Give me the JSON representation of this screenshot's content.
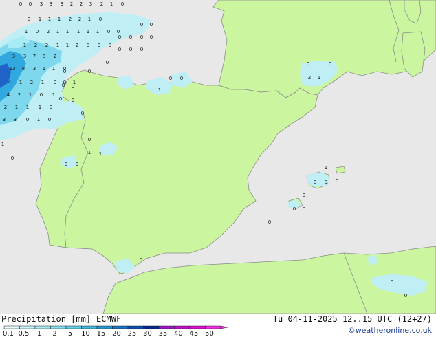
{
  "title": {
    "label": "Precipitation [mm]",
    "model": "ECMWF"
  },
  "valid_time": "Tu 04-11-2025 12..15 UTC (12+27)",
  "credit": "©weatheronline.co.uk",
  "colors": {
    "sea": "#e8e8e8",
    "land": "#ccf5a0",
    "border": "#8a8a8a",
    "precip_light": "#bfeef5",
    "precip_mid": "#7dd8ee",
    "precip_high": "#31a9e0",
    "precip_max": "#1f63c8"
  },
  "scale": {
    "ticks": [
      "0.1",
      "0.5",
      "1",
      "2",
      "5",
      "10",
      "15",
      "20",
      "25",
      "30",
      "35",
      "40",
      "45",
      "50"
    ],
    "colors": [
      "#e8fbfd",
      "#c8f3fa",
      "#a6ebf6",
      "#86e0f2",
      "#63d0ec",
      "#3fb9e3",
      "#2497d6",
      "#1773c4",
      "#0a4fb0",
      "#03288f",
      "#9d13c7",
      "#c10ecc",
      "#e00ad2",
      "#f72be6"
    ]
  },
  "map_values": {
    "row1": [
      "0",
      "0",
      "3",
      "3",
      "3",
      "2",
      "2",
      "3",
      "2",
      "1",
      "0"
    ],
    "row2": [
      "0",
      "1",
      "1",
      "1",
      "2",
      "2",
      "1",
      "0"
    ],
    "row3": [
      "1",
      "0",
      "2",
      "1",
      "1",
      "1",
      "1",
      "1",
      "0",
      "0"
    ],
    "row4": [
      "1",
      "2",
      "2",
      "1",
      "1",
      "2",
      "0",
      "0",
      "0"
    ],
    "row5": [
      "3",
      "3",
      "7",
      "8",
      "2"
    ],
    "row6": [
      "13",
      "8",
      "3",
      "1",
      "1",
      "0"
    ],
    "row7": [
      "4",
      "1",
      "2",
      "1",
      "0",
      "0",
      "1"
    ],
    "row8": [
      "4",
      "2",
      "1",
      "0",
      "1"
    ],
    "row9": [
      "2",
      "1",
      "1",
      "1",
      "0"
    ],
    "row10": [
      "3",
      "3",
      "0",
      "1",
      "0"
    ],
    "scattered": [
      "0",
      "0",
      "0",
      "0",
      "0",
      "0",
      "0",
      "0",
      "0",
      "0",
      "0",
      "0",
      "0",
      "0",
      "0",
      "0",
      "0",
      "0",
      "0",
      "0",
      "0",
      "0",
      "0",
      "0",
      "0",
      "1",
      "2",
      "1",
      "1",
      "1",
      "1"
    ]
  }
}
